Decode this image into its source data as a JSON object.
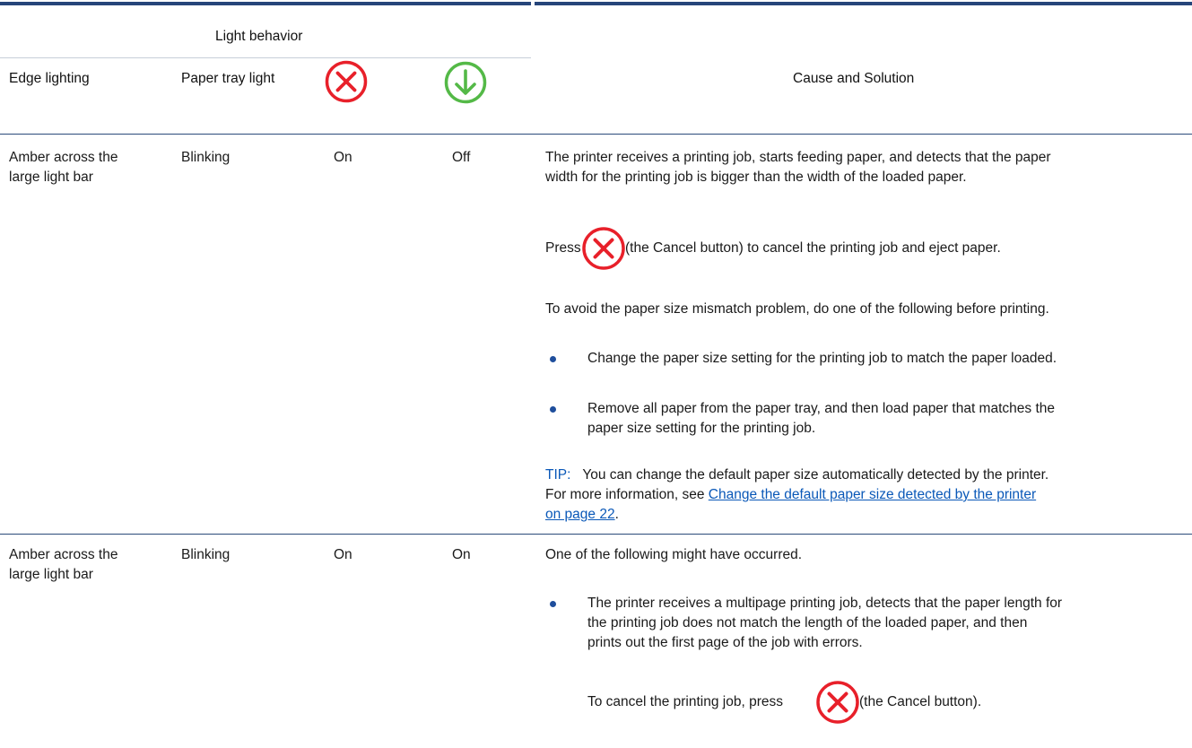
{
  "header": {
    "light_behavior": "Light behavior",
    "col_edge": "Edge lighting",
    "col_tray": "Paper tray light",
    "col_cause": "Cause and Solution",
    "icons": [
      "cancel-x-icon",
      "resume-down-arrow-icon"
    ]
  },
  "colors": {
    "rule": "#26457a",
    "cancel_red": "#e8202a",
    "resume_green": "#54b947",
    "link_blue": "#0a58b8"
  },
  "rows": [
    {
      "edge": "Amber across the large light bar",
      "edge_l1": "Amber across the",
      "edge_l2": "large light bar",
      "tray": "Blinking",
      "cancel": "On",
      "resume": "Off",
      "p1_l1": "The printer receives a printing job, starts feeding paper, and detects that the paper",
      "p1_l2": "width for the printing job is bigger than the width of the loaded paper.",
      "press_pre": "Press",
      "press_post": "(the Cancel button) to cancel the printing job and eject paper.",
      "avoid": "To avoid the paper size mismatch problem, do one of the following before printing.",
      "bullet1": "Change the paper size setting for the printing job to match the paper loaded.",
      "bullet2_l1": "Remove all paper from the paper tray, and then load paper that matches the",
      "bullet2_l2": "paper size setting for the printing job.",
      "tip_label": "TIP:",
      "tip_text_l1": "You can change the default paper size automatically detected by the printer.",
      "tip_text_l2": "For more information, see",
      "tip_link_l2": "Change the default paper size detected by the printer",
      "tip_link_l3": "on page 22",
      "tip_end": "."
    },
    {
      "edge_l1": "Amber across the",
      "edge_l2": "large light bar",
      "tray": "Blinking",
      "cancel": "On",
      "resume": "On",
      "intro": "One of the following might have occurred.",
      "bullet1_l1": "The printer receives a multipage printing job, detects that the paper length for",
      "bullet1_l2": "the printing job does not match the length of the loaded paper, and then",
      "bullet1_l3": "prints out the first page of the job with errors.",
      "cancel_pre": "To cancel the printing job, press",
      "cancel_post": "(the Cancel button)."
    }
  ]
}
